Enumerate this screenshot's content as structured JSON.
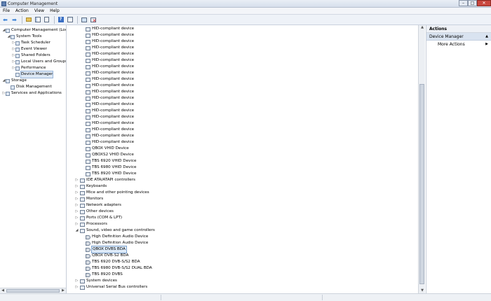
{
  "window": {
    "title": "Computer Management",
    "buttons": {
      "minimize": "–",
      "maximize": "□",
      "close": "✕"
    }
  },
  "menu": [
    "File",
    "Action",
    "View",
    "Help"
  ],
  "toolbar": {
    "icons": [
      "back-arrow-icon",
      "forward-arrow-icon",
      "up-folder-icon",
      "show-hide-console-tree-icon",
      "export-icon",
      "help-icon",
      "properties-icon",
      "scan-hardware-icon",
      "uninstall-icon"
    ]
  },
  "tree": [
    {
      "label": "Computer Management (Local",
      "level": 0,
      "expander": "◢",
      "icon": "computer-icon"
    },
    {
      "label": "System Tools",
      "level": 1,
      "expander": "◢",
      "icon": "tools-icon"
    },
    {
      "label": "Task Scheduler",
      "level": 2,
      "expander": "▷",
      "icon": "task-scheduler-icon"
    },
    {
      "label": "Event Viewer",
      "level": 2,
      "expander": "▷",
      "icon": "event-viewer-icon"
    },
    {
      "label": "Shared Folders",
      "level": 2,
      "expander": "▷",
      "icon": "shared-folder-icon"
    },
    {
      "label": "Local Users and Groups",
      "level": 2,
      "expander": "▷",
      "icon": "users-icon"
    },
    {
      "label": "Performance",
      "level": 2,
      "expander": "▷",
      "icon": "performance-icon"
    },
    {
      "label": "Device Manager",
      "level": 2,
      "expander": "",
      "icon": "device-manager-icon",
      "selected": true
    },
    {
      "label": "Storage",
      "level": 0,
      "expander": "◢",
      "icon": "storage-icon"
    },
    {
      "label": "Disk Management",
      "level": 1,
      "expander": "",
      "icon": "disk-icon"
    },
    {
      "label": "Services and Applications",
      "level": 0,
      "expander": "▷",
      "icon": "services-icon"
    }
  ],
  "devices": [
    {
      "label": "HID-compliant device",
      "level": 2,
      "icon": "hid-icon"
    },
    {
      "label": "HID-compliant device",
      "level": 2,
      "icon": "hid-icon"
    },
    {
      "label": "HID-compliant device",
      "level": 2,
      "icon": "hid-icon"
    },
    {
      "label": "HID-compliant device",
      "level": 2,
      "icon": "hid-icon"
    },
    {
      "label": "HID-compliant device",
      "level": 2,
      "icon": "hid-icon"
    },
    {
      "label": "HID-compliant device",
      "level": 2,
      "icon": "hid-icon"
    },
    {
      "label": "HID-compliant device",
      "level": 2,
      "icon": "hid-icon"
    },
    {
      "label": "HID-compliant device",
      "level": 2,
      "icon": "hid-icon"
    },
    {
      "label": "HID-compliant device",
      "level": 2,
      "icon": "hid-icon"
    },
    {
      "label": "HID-compliant device",
      "level": 2,
      "icon": "hid-icon"
    },
    {
      "label": "HID-compliant device",
      "level": 2,
      "icon": "hid-icon"
    },
    {
      "label": "HID-compliant device",
      "level": 2,
      "icon": "hid-icon"
    },
    {
      "label": "HID-compliant device",
      "level": 2,
      "icon": "hid-icon"
    },
    {
      "label": "HID-compliant device",
      "level": 2,
      "icon": "hid-icon"
    },
    {
      "label": "HID-compliant device",
      "level": 2,
      "icon": "hid-icon"
    },
    {
      "label": "HID-compliant device",
      "level": 2,
      "icon": "hid-icon"
    },
    {
      "label": "HID-compliant device",
      "level": 2,
      "icon": "hid-icon"
    },
    {
      "label": "HID-compliant device",
      "level": 2,
      "icon": "hid-icon"
    },
    {
      "label": "HID-compliant device",
      "level": 2,
      "icon": "hid-icon"
    },
    {
      "label": "QBOX VHID Device",
      "level": 2,
      "icon": "hid-icon"
    },
    {
      "label": "QBOXS2 VHID Device",
      "level": 2,
      "icon": "hid-icon"
    },
    {
      "label": "TBS 6920 VHID Device",
      "level": 2,
      "icon": "hid-icon"
    },
    {
      "label": "TBS 6980 VHID Device",
      "level": 2,
      "icon": "hid-icon"
    },
    {
      "label": "TBS 8920 VHID Device",
      "level": 2,
      "icon": "hid-icon"
    },
    {
      "label": "IDE ATA/ATAPI controllers",
      "level": 1,
      "expander": "▷",
      "icon": "ide-controller-icon"
    },
    {
      "label": "Keyboards",
      "level": 1,
      "expander": "▷",
      "icon": "keyboard-icon"
    },
    {
      "label": "Mice and other pointing devices",
      "level": 1,
      "expander": "▷",
      "icon": "mouse-icon"
    },
    {
      "label": "Monitors",
      "level": 1,
      "expander": "▷",
      "icon": "monitor-icon"
    },
    {
      "label": "Network adapters",
      "level": 1,
      "expander": "▷",
      "icon": "network-adapter-icon"
    },
    {
      "label": "Other devices",
      "level": 1,
      "expander": "▷",
      "icon": "other-device-icon"
    },
    {
      "label": "Ports (COM & LPT)",
      "level": 1,
      "expander": "▷",
      "icon": "port-icon"
    },
    {
      "label": "Processors",
      "level": 1,
      "expander": "▷",
      "icon": "processor-icon"
    },
    {
      "label": "Sound, video and game controllers",
      "level": 1,
      "expander": "◢",
      "icon": "sound-icon"
    },
    {
      "label": "High Definition Audio Device",
      "level": 2,
      "icon": "audio-device-icon"
    },
    {
      "label": "High Definition Audio Device",
      "level": 2,
      "icon": "audio-device-icon"
    },
    {
      "label": "QBOX DVBS BDA",
      "level": 2,
      "icon": "audio-device-icon",
      "selected": true
    },
    {
      "label": "QBOX DVB-S2 BDA",
      "level": 2,
      "icon": "audio-device-icon"
    },
    {
      "label": "TBS 6920 DVB-S/S2 BDA",
      "level": 2,
      "icon": "audio-device-icon"
    },
    {
      "label": "TBS 6980 DVB-S/S2 DUAL BDA",
      "level": 2,
      "icon": "audio-device-icon"
    },
    {
      "label": "TBS 8920 DVBS",
      "level": 2,
      "icon": "audio-device-icon"
    },
    {
      "label": "System devices",
      "level": 1,
      "expander": "▷",
      "icon": "system-device-icon"
    },
    {
      "label": "Universal Serial Bus controllers",
      "level": 1,
      "expander": "▷",
      "icon": "usb-icon"
    }
  ],
  "actions": {
    "header": "Actions",
    "section": "Device Manager",
    "section_caret": "▲",
    "items": [
      {
        "label": "More Actions",
        "caret": "▶"
      }
    ]
  },
  "scroll_arrows": {
    "up": "▲",
    "down": "▼",
    "left": "◀",
    "right": "▶"
  }
}
